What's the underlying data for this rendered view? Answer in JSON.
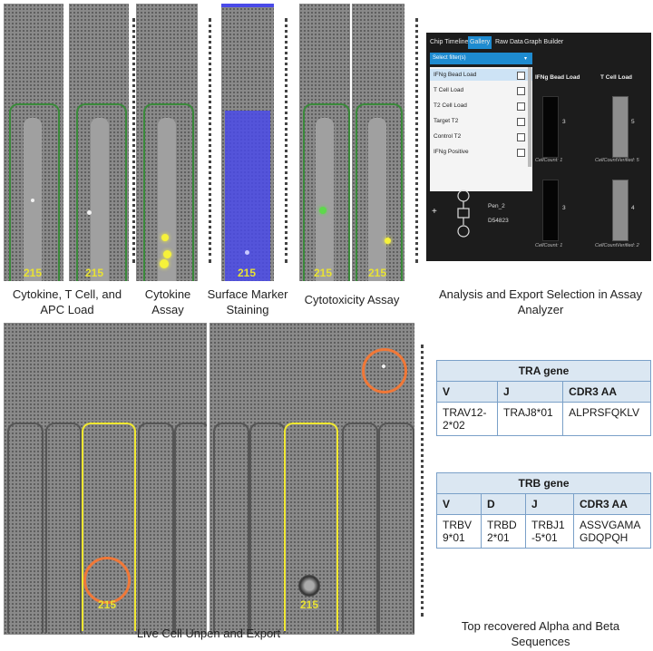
{
  "top_images": {
    "pen_label": "215",
    "captions": {
      "load": "Cytokine, T Cell, and APC Load",
      "cytokine": "Cytokine Assay",
      "surface": "Surface Marker Staining",
      "cytotox": "Cytotoxicity Assay",
      "analysis": "Analysis and Export Selection in Assay Analyzer"
    }
  },
  "analyzer": {
    "tabs": [
      "Chip Timeline",
      "Gallery",
      "Raw Data",
      "Graph Builder"
    ],
    "select_placeholder": "Select filter(s)",
    "filters": [
      "IFNg Bead Load",
      "T Cell Load",
      "T2 Cell Load",
      "Target T2",
      "Control T2",
      "IFNg Positive"
    ],
    "col_headers": [
      "IFNg Bead Load",
      "T Cell Load"
    ],
    "row1": {
      "count_a": "3",
      "count_b": "5",
      "label_a": "CellCount: 1",
      "label_b": "CellCountVerified: 5"
    },
    "row2": {
      "count_a": "3",
      "count_b": "4",
      "label_a": "CellCount: 1",
      "label_b": "CellCountVerified: 2",
      "pen_id": "Pen_2",
      "chip_id": "D54823"
    },
    "plus": "+"
  },
  "bottom": {
    "pen_label": "215",
    "caption_unpen": "Live Cell Unpen and Export",
    "caption_seq": "Top recovered Alpha and Beta Sequences"
  },
  "tra": {
    "title": "TRA gene",
    "headers": [
      "V",
      "J",
      "CDR3 AA"
    ],
    "row": [
      "TRAV12-2*02",
      "TRAJ8*01",
      "ALPRSFQKLV"
    ]
  },
  "trb": {
    "title": "TRB gene",
    "headers": [
      "V",
      "D",
      "J",
      "CDR3 AA"
    ],
    "row": [
      "TRBV9*01",
      "TRBD2*01",
      "TRBJ1-5*01",
      "ASSVGAMAGDQPQH"
    ]
  },
  "colors": {
    "pen_green": "#3a8a3a",
    "pen_yellow": "#f0e830",
    "circle_orange": "#f07838",
    "stain_blue": "#4a4ae8",
    "table_border": "#7aa0c8",
    "table_header": "#dbe7f2"
  }
}
